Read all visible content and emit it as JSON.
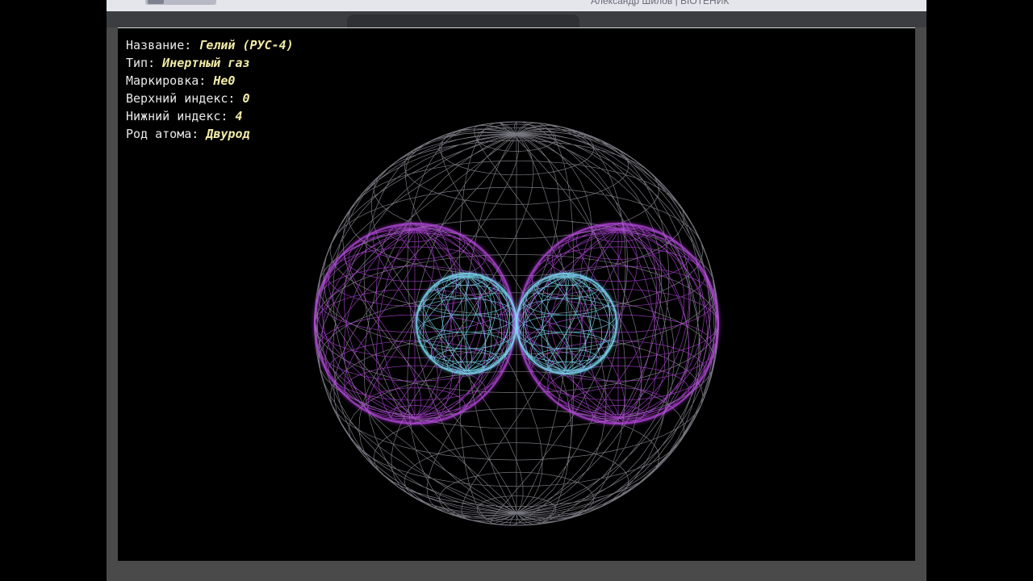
{
  "header": {
    "caption": "Александр Шилов | BIOТЕНИК"
  },
  "info": {
    "rows": [
      {
        "label": "Название:",
        "value": "Гелий (РУС-4)"
      },
      {
        "label": "Тип:",
        "value": "Инертный газ"
      },
      {
        "label": "Маркировка:",
        "value": "He0"
      },
      {
        "label": "Верхний индекс:",
        "value": "0"
      },
      {
        "label": "Нижний индекс:",
        "value": "4"
      },
      {
        "label": "Род атома:",
        "value": "Двурод"
      }
    ]
  },
  "colors": {
    "outer_shell": "#d8d8e8",
    "middle_shells": "#c44cf0",
    "inner_shells": "#7fe6ff",
    "label_value": "#f2eba8",
    "label_text": "#e9e9e9"
  },
  "icons": [
    "wireframe-sphere-outer",
    "wireframe-sphere-middle-left",
    "wireframe-sphere-middle-right",
    "wireframe-sphere-inner-left",
    "wireframe-sphere-inner-right"
  ]
}
